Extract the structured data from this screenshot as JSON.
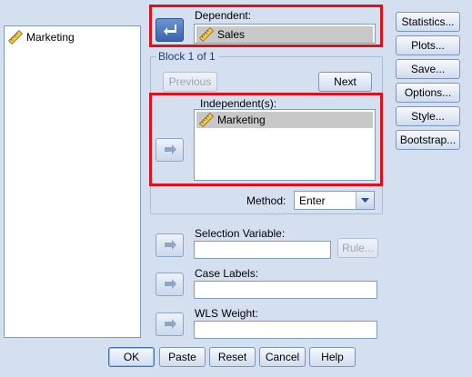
{
  "variable_list": {
    "items": [
      {
        "label": "Marketing",
        "icon": "scale-ruler-icon"
      }
    ]
  },
  "dependent": {
    "label": "Dependent:",
    "value": "Sales"
  },
  "block": {
    "title": "Block 1 of 1",
    "previous_label": "Previous",
    "next_label": "Next"
  },
  "independents": {
    "label": "Independent(s):",
    "items": [
      "Marketing"
    ]
  },
  "method": {
    "label": "Method:",
    "value": "Enter"
  },
  "selection_variable": {
    "label": "Selection Variable:",
    "rule_label": "Rule..."
  },
  "case_labels": {
    "label": "Case Labels:"
  },
  "wls_weight": {
    "label": "WLS Weight:"
  },
  "side_buttons": [
    "Statistics...",
    "Plots...",
    "Save...",
    "Options...",
    "Style...",
    "Bootstrap..."
  ],
  "footer": {
    "ok": "OK",
    "paste": "Paste",
    "reset": "Reset",
    "cancel": "Cancel",
    "help": "Help"
  },
  "colors": {
    "background": "#d4e0f0",
    "highlight": "#e0101a",
    "active_arrow": "#3a63b0"
  }
}
